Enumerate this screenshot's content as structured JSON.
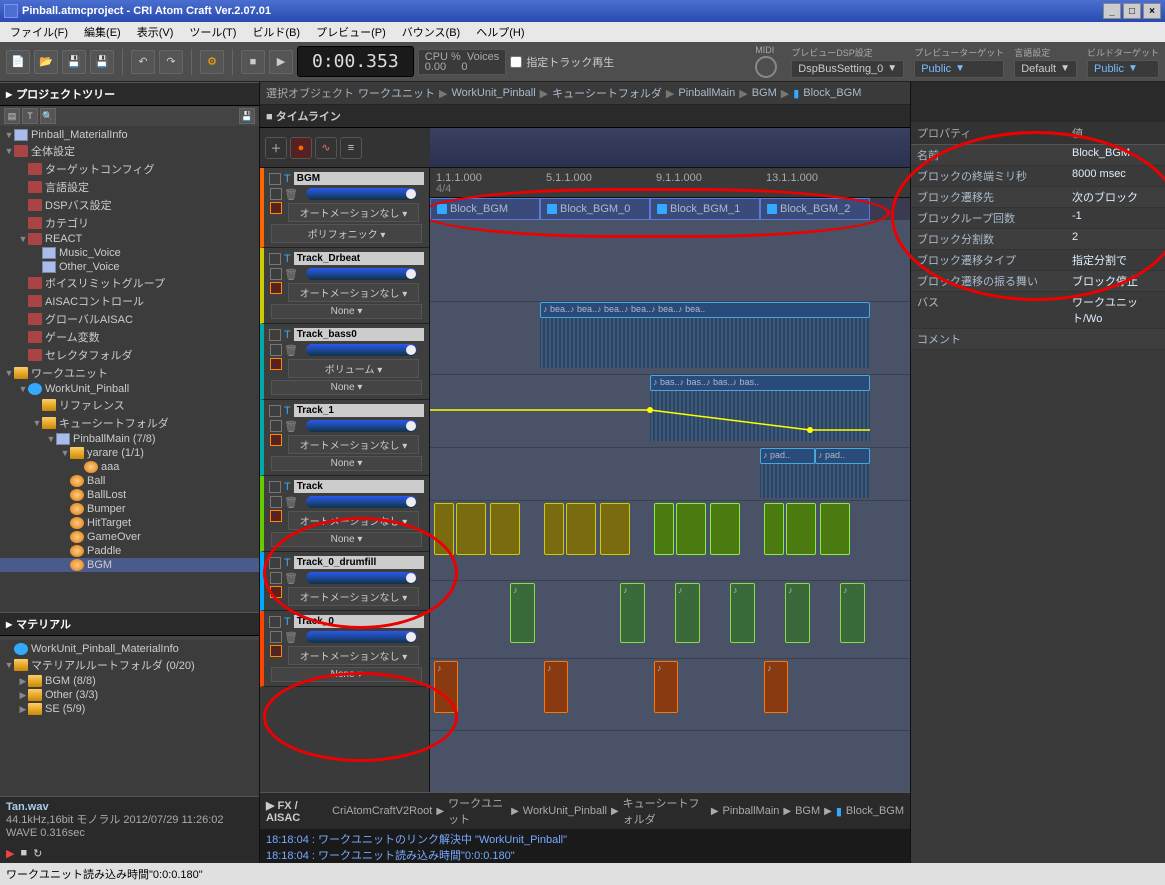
{
  "title": "Pinball.atmcproject - CRI Atom Craft Ver.2.07.01",
  "menu": [
    "ファイル(F)",
    "編集(E)",
    "表示(V)",
    "ツール(T)",
    "ビルド(B)",
    "プレビュー(P)",
    "バウンス(B)",
    "ヘルプ(H)"
  ],
  "time": "0:00.353",
  "cpu": {
    "l1": "CPU %",
    "l2": "0.00",
    "v1": "Voices",
    "v2": "0"
  },
  "toolbar": {
    "chk": "指定トラック再生",
    "midi": "MIDI",
    "dsp_lbl": "プレビューDSP設定",
    "dsp": "DspBusSetting_0",
    "prev_lbl": "プレビューターゲット",
    "prev": "Public",
    "lang_lbl": "言語設定",
    "lang": "Default",
    "build_lbl": "ビルドターゲット",
    "build": "Public"
  },
  "panels": {
    "project": "プロジェクトツリー",
    "material": "マテリアル",
    "timeline": "タイムライン",
    "fx": "FX / AISAC",
    "props": "プロパティ",
    "val": "値"
  },
  "bc": {
    "sel": "選択オブジェクト",
    "items": [
      "ワークユニット",
      "WorkUnit_Pinball",
      "キューシートフォルダ",
      "PinballMain",
      "BGM",
      "Block_BGM"
    ]
  },
  "tree": [
    {
      "d": 0,
      "tw": "▼",
      "ic": "page",
      "t": "Pinball_MaterialInfo"
    },
    {
      "d": 0,
      "tw": "▼",
      "ic": "fred",
      "t": "全体設定"
    },
    {
      "d": 1,
      "tw": "",
      "ic": "fred",
      "t": "ターゲットコンフィグ"
    },
    {
      "d": 1,
      "tw": "",
      "ic": "fred",
      "t": "言語設定"
    },
    {
      "d": 1,
      "tw": "",
      "ic": "fred",
      "t": "DSPバス設定"
    },
    {
      "d": 1,
      "tw": "",
      "ic": "fred",
      "t": "カテゴリ"
    },
    {
      "d": 1,
      "tw": "▼",
      "ic": "fred",
      "t": "REACT"
    },
    {
      "d": 2,
      "tw": "",
      "ic": "page",
      "t": "Music_Voice"
    },
    {
      "d": 2,
      "tw": "",
      "ic": "page",
      "t": "Other_Voice"
    },
    {
      "d": 1,
      "tw": "",
      "ic": "fred",
      "t": "ボイスリミットグループ"
    },
    {
      "d": 1,
      "tw": "",
      "ic": "fred",
      "t": "AISACコントロール"
    },
    {
      "d": 1,
      "tw": "",
      "ic": "fred",
      "t": "グローバルAISAC"
    },
    {
      "d": 1,
      "tw": "",
      "ic": "fred",
      "t": "ゲーム変数"
    },
    {
      "d": 1,
      "tw": "",
      "ic": "fred",
      "t": "セレクタフォルダ"
    },
    {
      "d": 0,
      "tw": "▼",
      "ic": "folder",
      "t": "ワークユニット"
    },
    {
      "d": 1,
      "tw": "▼",
      "ic": "fblue",
      "t": "WorkUnit_Pinball"
    },
    {
      "d": 2,
      "tw": "",
      "ic": "folder",
      "t": "リファレンス"
    },
    {
      "d": 2,
      "tw": "▼",
      "ic": "folder",
      "t": "キューシートフォルダ"
    },
    {
      "d": 3,
      "tw": "▼",
      "ic": "page",
      "t": "PinballMain  (7/8)"
    },
    {
      "d": 4,
      "tw": "▼",
      "ic": "folder",
      "t": "yarare  (1/1)"
    },
    {
      "d": 5,
      "tw": "",
      "ic": "ball",
      "t": "aaa"
    },
    {
      "d": 4,
      "tw": "",
      "ic": "ball",
      "t": "Ball"
    },
    {
      "d": 4,
      "tw": "",
      "ic": "ball",
      "t": "BallLost"
    },
    {
      "d": 4,
      "tw": "",
      "ic": "ball",
      "t": "Bumper"
    },
    {
      "d": 4,
      "tw": "",
      "ic": "ball",
      "t": "HitTarget"
    },
    {
      "d": 4,
      "tw": "",
      "ic": "ball",
      "t": "GameOver"
    },
    {
      "d": 4,
      "tw": "",
      "ic": "ball",
      "t": "Paddle"
    },
    {
      "d": 4,
      "tw": "",
      "ic": "ball",
      "t": "BGM",
      "sel": true
    }
  ],
  "material_tree": [
    {
      "d": 0,
      "tw": "",
      "ic": "fblue",
      "t": "WorkUnit_Pinball_MaterialInfo"
    },
    {
      "d": 0,
      "tw": "▼",
      "ic": "folder",
      "t": "マテリアルルートフォルダ  (0/20)"
    },
    {
      "d": 1,
      "tw": "▶",
      "ic": "folder",
      "t": "BGM  (8/8)"
    },
    {
      "d": 1,
      "tw": "▶",
      "ic": "folder",
      "t": "Other  (3/3)"
    },
    {
      "d": 1,
      "tw": "▶",
      "ic": "folder",
      "t": "SE  (5/9)"
    }
  ],
  "matinfo": {
    "name": "Tan.wav",
    "line2": "44.1kHz,16bit モノラル   2012/07/29 11:26:02",
    "line3": "WAVE 0.316sec"
  },
  "ruler": [
    "1.1.1.000",
    "5.1.1.000",
    "9.1.1.000",
    "13.1.1.000"
  ],
  "ruler_meter": "4/4",
  "blocks": [
    "Block_BGM",
    "Block_BGM_0",
    "Block_BGM_1",
    "Block_BGM_2"
  ],
  "tracks": [
    {
      "name": "BGM",
      "cls": "bgm",
      "auto": "オートメーションなし",
      "drop": "ポリフォニック"
    },
    {
      "name": "Track_Drbeat",
      "cls": "t0",
      "auto": "オートメーションなし",
      "drop": "None"
    },
    {
      "name": "Track_bass0",
      "cls": "t1",
      "auto": "ボリューム",
      "drop": "None"
    },
    {
      "name": "Track_1",
      "cls": "t1",
      "auto": "オートメーションなし",
      "drop": "None"
    },
    {
      "name": "Track",
      "cls": "tr",
      "auto": "オートメーションなし",
      "drop": "None"
    },
    {
      "name": "Track_0_drumfill",
      "cls": "drum",
      "auto": "オートメーションなし",
      "drop": ""
    },
    {
      "name": "Track_0",
      "cls": "tr0",
      "auto": "オートメーションなし",
      "drop": "None"
    }
  ],
  "props": [
    {
      "k": "名前",
      "v": "Block_BGM"
    },
    {
      "k": "ブロックの終端ミリ秒",
      "v": "8000 msec"
    },
    {
      "k": "ブロック遷移先",
      "v": "次のブロック"
    },
    {
      "k": "ブロックループ回数",
      "v": "-1"
    },
    {
      "k": "ブロック分割数",
      "v": "2"
    },
    {
      "k": "ブロック遷移タイプ",
      "v": "指定分割で"
    },
    {
      "k": "ブロック遷移の振る舞い",
      "v": "ブロック停止"
    },
    {
      "k": "バス",
      "v": "ワークユニット/Wo"
    },
    {
      "k": "コメント",
      "v": ""
    }
  ],
  "bc2": [
    "CriAtomCraftV2Root",
    "ワークユニット",
    "WorkUnit_Pinball",
    "キューシートフォルダ",
    "PinballMain",
    "BGM",
    "Block_BGM"
  ],
  "log": [
    "18:18:04 :   ワークユニットのリンク解決中 \"WorkUnit_Pinball\"",
    "18:18:04 :   ワークユニット読み込み時間\"0:0:0.180\""
  ],
  "status": "ワークユニット読み込み時間\"0:0:0.180\""
}
